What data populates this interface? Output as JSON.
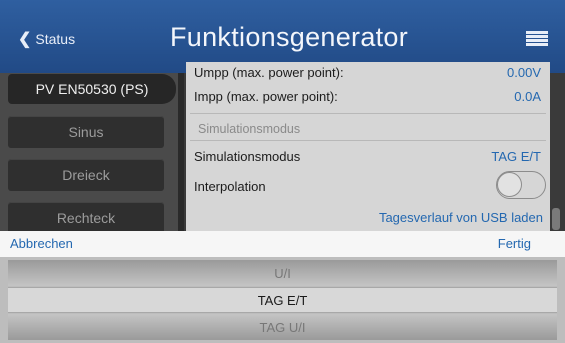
{
  "header": {
    "back_label": "Status",
    "title": "Funktionsgenerator"
  },
  "modes": {
    "active": "PV EN50530 (PS)",
    "items": [
      "Sinus",
      "Dreieck",
      "Rechteck"
    ]
  },
  "panel": {
    "rows": [
      {
        "label": "Umpp (max. power point):",
        "value": "0.00V"
      },
      {
        "label": "Impp (max. power point):",
        "value": "0.0A"
      }
    ],
    "section_title": "Simulationsmodus",
    "sim_mode_label": "Simulationsmodus",
    "sim_mode_value": "TAG E/T",
    "interpolation_label": "Interpolation",
    "interpolation_on": false,
    "usb_link": "Tagesverlauf von USB laden"
  },
  "picker": {
    "cancel_label": "Abbrechen",
    "done_label": "Fertig",
    "options": [
      "U/I",
      "TAG E/T",
      "TAG U/I"
    ],
    "selected": "TAG E/T"
  }
}
